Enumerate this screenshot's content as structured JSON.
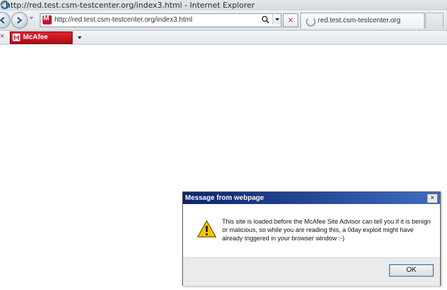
{
  "window": {
    "title": "http://red.test.csm-testcenter.org/index3.html - Internet Explorer"
  },
  "address_bar": {
    "url": "http://red.test.csm-testcenter.org/index3.html"
  },
  "tab": {
    "label": "red.test.csm-testcenter.org"
  },
  "command_bar": {
    "close_glyph": "×",
    "mcafee_label": "McAfee"
  },
  "dialog": {
    "title": "Message from webpage",
    "message": "This site is loaded before the McAfee Site Advisor can tell you if it is benign or malicious, so while you are reading this, a 0day exploit might have already triggered in your browser window :-)",
    "ok_label": "OK",
    "close_glyph": "×"
  },
  "stop_glyph": "×",
  "icons": [
    "ie-logo-icon",
    "back-icon",
    "forward-icon",
    "mcafee-shield-icon",
    "search-icon",
    "stop-icon",
    "loading-icon",
    "close-icon",
    "warning-icon"
  ],
  "colors": {
    "mcafee_red": "#c8102e",
    "dialog_title_start": "#0a246a",
    "dialog_title_end": "#3f6cc2"
  }
}
